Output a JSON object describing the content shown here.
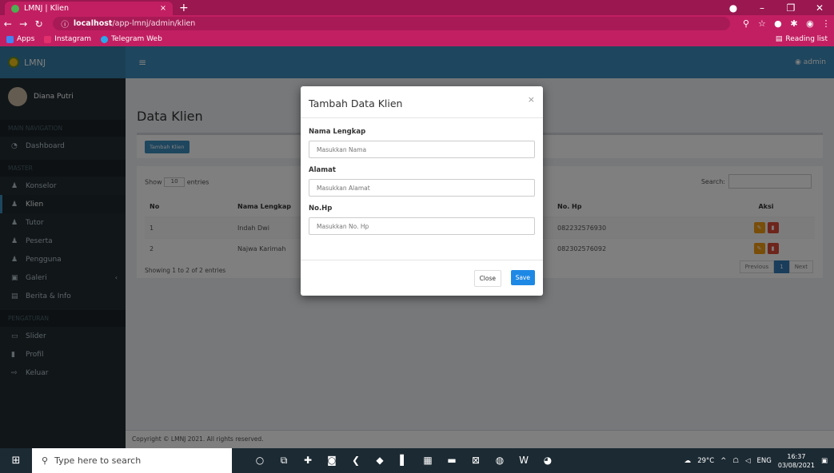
{
  "browser": {
    "tab_title": "LMNJ | Klien",
    "tab_close": "×",
    "new_tab": "+",
    "url_host": "localhost",
    "url_path": "/app-lmnj/admin/klien",
    "bookmarks": [
      "Apps",
      "Instagram",
      "Telegram Web"
    ],
    "reading_list": "Reading list"
  },
  "sidebar": {
    "brand": "LMNJ",
    "user_name": "Diana Putri",
    "section_main": "MAIN NAVIGATION",
    "dashboard": "Dashboard",
    "section_master": "MASTER",
    "items": [
      "Konselor",
      "Klien",
      "Tutor",
      "Peserta",
      "Pengguna",
      "Galeri",
      "Berita & Info"
    ],
    "section_settings": "PENGATURAN",
    "settings_items": [
      "Slider",
      "Profil",
      "Keluar"
    ]
  },
  "topnav": {
    "user": "admin"
  },
  "page": {
    "title": "Data Klien",
    "add_button": "Tambah Klien",
    "show_label": "Show",
    "show_value": "10",
    "entries_label": "entries",
    "search_label": "Search:",
    "columns": [
      "No",
      "Nama Lengkap",
      "No. Hp",
      "Aksi"
    ],
    "rows": [
      {
        "no": "1",
        "nama": "Indah Dwi",
        "hp": "082232576930"
      },
      {
        "no": "2",
        "nama": "Najwa Karimah",
        "hp": "082302576092"
      }
    ],
    "showing": "Showing 1 to 2 of 2 entries",
    "prev": "Previous",
    "page_num": "1",
    "next": "Next",
    "footer": "Copyright © LMNJ 2021. All rights reserved."
  },
  "modal": {
    "title": "Tambah Data Klien",
    "close_x": "×",
    "label_nama": "Nama Lengkap",
    "ph_nama": "Masukkan Nama",
    "label_alamat": "Alamat",
    "ph_alamat": "Masukkan Alamat",
    "label_hp": "No.Hp",
    "ph_hp": "Masukkan No. Hp",
    "close_btn": "Close",
    "save_btn": "Save"
  },
  "taskbar": {
    "search_placeholder": "Type here to search",
    "weather": "29°C",
    "lang": "ENG",
    "time": "16:37",
    "date": "03/08/2021"
  }
}
